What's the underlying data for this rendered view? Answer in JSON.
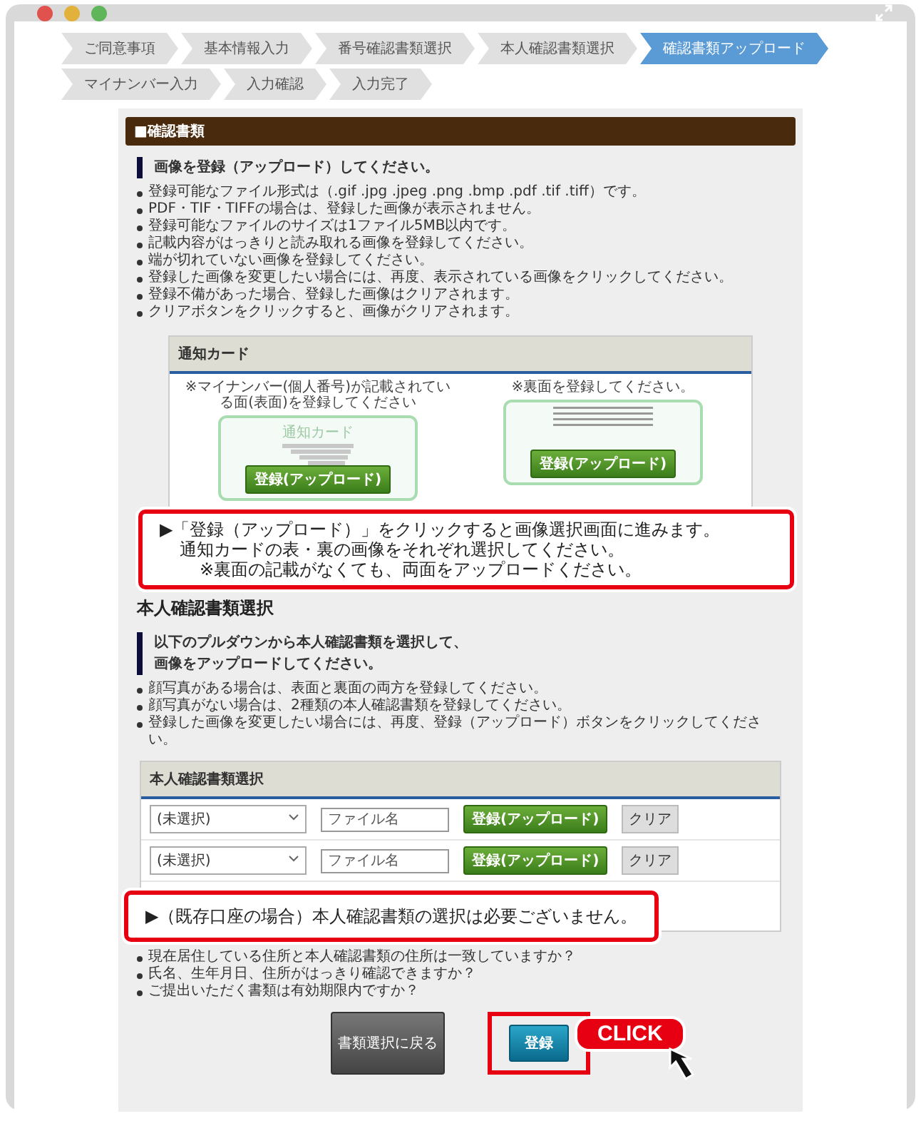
{
  "steps": [
    {
      "label": "ご同意事項",
      "selected": false
    },
    {
      "label": "基本情報入力",
      "selected": false
    },
    {
      "label": "番号確認書類選択",
      "selected": false
    },
    {
      "label": "本人確認書類選択",
      "selected": false
    },
    {
      "label": "確認書類アップロード",
      "selected": true
    },
    {
      "label": "マイナンバー入力",
      "selected": false
    },
    {
      "label": "入力確認",
      "selected": false
    },
    {
      "label": "入力完了",
      "selected": false
    }
  ],
  "section_header": "■確認書類",
  "upload_heading": "画像を登録（アップロード）してください。",
  "upload_notes": [
    "登録可能なファイル形式は（.gif .jpg .jpeg .png .bmp .pdf .tif .tiff）です。",
    "PDF・TIF・TIFFの場合は、登録した画像が表示されません。",
    "登録可能なファイルのサイズは1ファイル5MB以内です。",
    "記載内容がはっきりと読み取れる画像を登録してください。",
    "端が切れていない画像を登録してください。",
    "登録した画像を変更したい場合には、再度、表示されている画像をクリックしてください。",
    "登録不備があった場合、登録した画像はクリアされます。",
    "クリアボタンをクリックすると、画像がクリアされます。"
  ],
  "card_panel": {
    "title": "通知カード",
    "front": {
      "caption": "※マイナンバー(個人番号)が記載されている面(表面)を登録してください",
      "card_label": "通知カード",
      "button": "登録(アップロード)"
    },
    "back": {
      "caption": "※裏面を登録してください。",
      "button": "登録(アップロード)"
    },
    "callout": [
      "▶「登録（アップロード）」をクリックすると画像選択画面に進みます。",
      "通知カードの表・裏の画像をそれぞれ選択してください。",
      "※裏面の記載がなくても、両面をアップロードください。"
    ]
  },
  "id_section": {
    "title": "本人確認書類選択",
    "heading_lines": [
      "以下のプルダウンから本人確認書類を選択して、",
      "画像をアップロードしてください。"
    ],
    "notes": [
      "顔写真がある場合は、表面と裏面の両方を登録してください。",
      "顔写真がない場合は、2種類の本人確認書類を登録してください。",
      "登録した画像を変更したい場合には、再度、登録（アップロード）ボタンをクリックしてください。"
    ],
    "table": {
      "title": "本人確認書類選択",
      "rows": [
        {
          "select": "(未選択)",
          "placeholder": "ファイル名",
          "upload": "登録(アップロード)",
          "clear": "クリア"
        },
        {
          "select": "(未選択)",
          "placeholder": "ファイル名",
          "upload": "登録(アップロード)",
          "clear": "クリア"
        }
      ]
    },
    "callout": "▶（既存口座の場合）本人確認書類の選択は必要ございません。"
  },
  "checks": [
    "現在居住している住所と本人確認書類の住所は一致していますか？",
    "氏名、生年月日、住所がはっきり確認できますか？",
    "ご提出いただく書類は有効期限内ですか？"
  ],
  "buttons": {
    "back": "書類選択に戻る",
    "submit": "登録"
  },
  "click_badge": "CLICK"
}
